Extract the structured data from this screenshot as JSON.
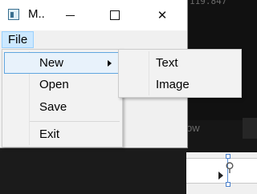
{
  "background": {
    "readout": "119.847",
    "partial_label": "ow",
    "link_icon": "link-icon"
  },
  "window": {
    "title": "M..",
    "controls": {
      "minimize": "minimize-icon",
      "maximize": "maximize-icon",
      "close": "close-icon",
      "close_glyph": "✕"
    }
  },
  "menubar": {
    "items": [
      {
        "label": "File",
        "active": true
      }
    ]
  },
  "file_menu": {
    "items": [
      {
        "label": "New",
        "has_submenu": true,
        "highlighted": true
      },
      {
        "label": "Open"
      },
      {
        "label": "Save"
      },
      {
        "label": "Exit"
      }
    ]
  },
  "new_submenu": {
    "items": [
      {
        "label": "Text"
      },
      {
        "label": "Image"
      }
    ]
  },
  "colors": {
    "menu_highlight": "#cce8ff",
    "menu_highlight_border": "#99d1ff",
    "item_hover_border": "#60a6e0"
  }
}
